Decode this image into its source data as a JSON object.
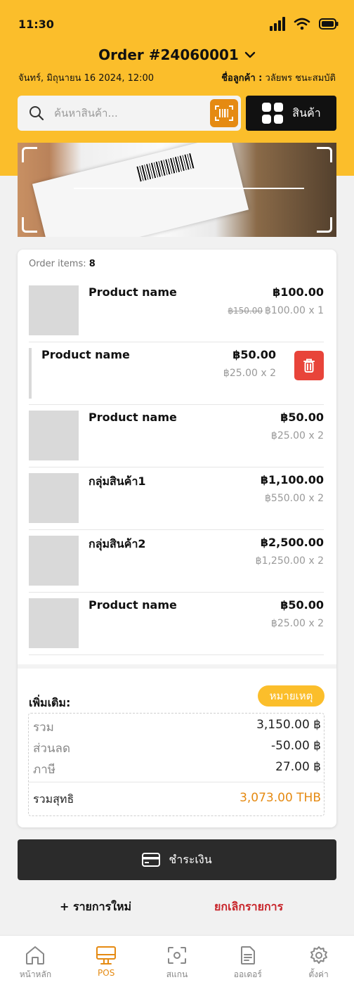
{
  "status": {
    "time": "11:30"
  },
  "header": {
    "order_title": "Order #24060001",
    "date": "จันทร์, มิถุนายน 16 2024, 12:00",
    "customer_label": "ชื่อลูกค้า :",
    "customer_name": "วลัยพร ชนะสมบัติ"
  },
  "search": {
    "placeholder": "ค้นหาสินค้า..."
  },
  "product_button": {
    "label": "สินค้า"
  },
  "order": {
    "items_label": "Order items:",
    "items_count": "8",
    "items": [
      {
        "name": "Product name",
        "price": "฿100.00",
        "original": "฿150.00",
        "unit": "฿100.00 x 1"
      },
      {
        "name": "Product name",
        "price": "฿50.00",
        "unit": "฿25.00 x 2"
      },
      {
        "name": "Product name",
        "price": "฿50.00",
        "unit": "฿25.00 x 2"
      },
      {
        "name": "กลุ่มสินค้า1",
        "price": "฿1,100.00",
        "unit": "฿550.00 x 2"
      },
      {
        "name": "กลุ่มสินค้า2",
        "price": "฿2,500.00",
        "unit": "฿1,250.00 x 2"
      },
      {
        "name": "Product name",
        "price": "฿50.00",
        "unit": "฿25.00 x 2"
      }
    ]
  },
  "extra": {
    "label": "เพิ่มเติม:",
    "note_button": "หมายเหตุ"
  },
  "summary": {
    "subtotal_label": "รวม",
    "subtotal": "3,150.00 ฿",
    "discount_label": "ส่วนลด",
    "discount": "-50.00 ฿",
    "tax_label": "ภาษี",
    "tax": "27.00 ฿",
    "total_label": "รวมสุทธิ",
    "total": "3,073.00 THB"
  },
  "actions": {
    "pay": "ชำระเงิน",
    "new_item": "+ รายการใหม่",
    "cancel": "ยกเลิกรายการ"
  },
  "nav": [
    {
      "label": "หน้าหลัก",
      "icon": "home-icon"
    },
    {
      "label": "POS",
      "icon": "pos-icon",
      "active": true
    },
    {
      "label": "สแกน",
      "icon": "scan-icon"
    },
    {
      "label": "ออเดอร์",
      "icon": "document-icon"
    },
    {
      "label": "ตั้งค่า",
      "icon": "settings-icon"
    }
  ],
  "colors": {
    "accent": "#fbbe2b",
    "orange": "#e58a12",
    "danger": "#e8443a",
    "cancel_text": "#c8252b",
    "dark": "#2b2b2b"
  }
}
